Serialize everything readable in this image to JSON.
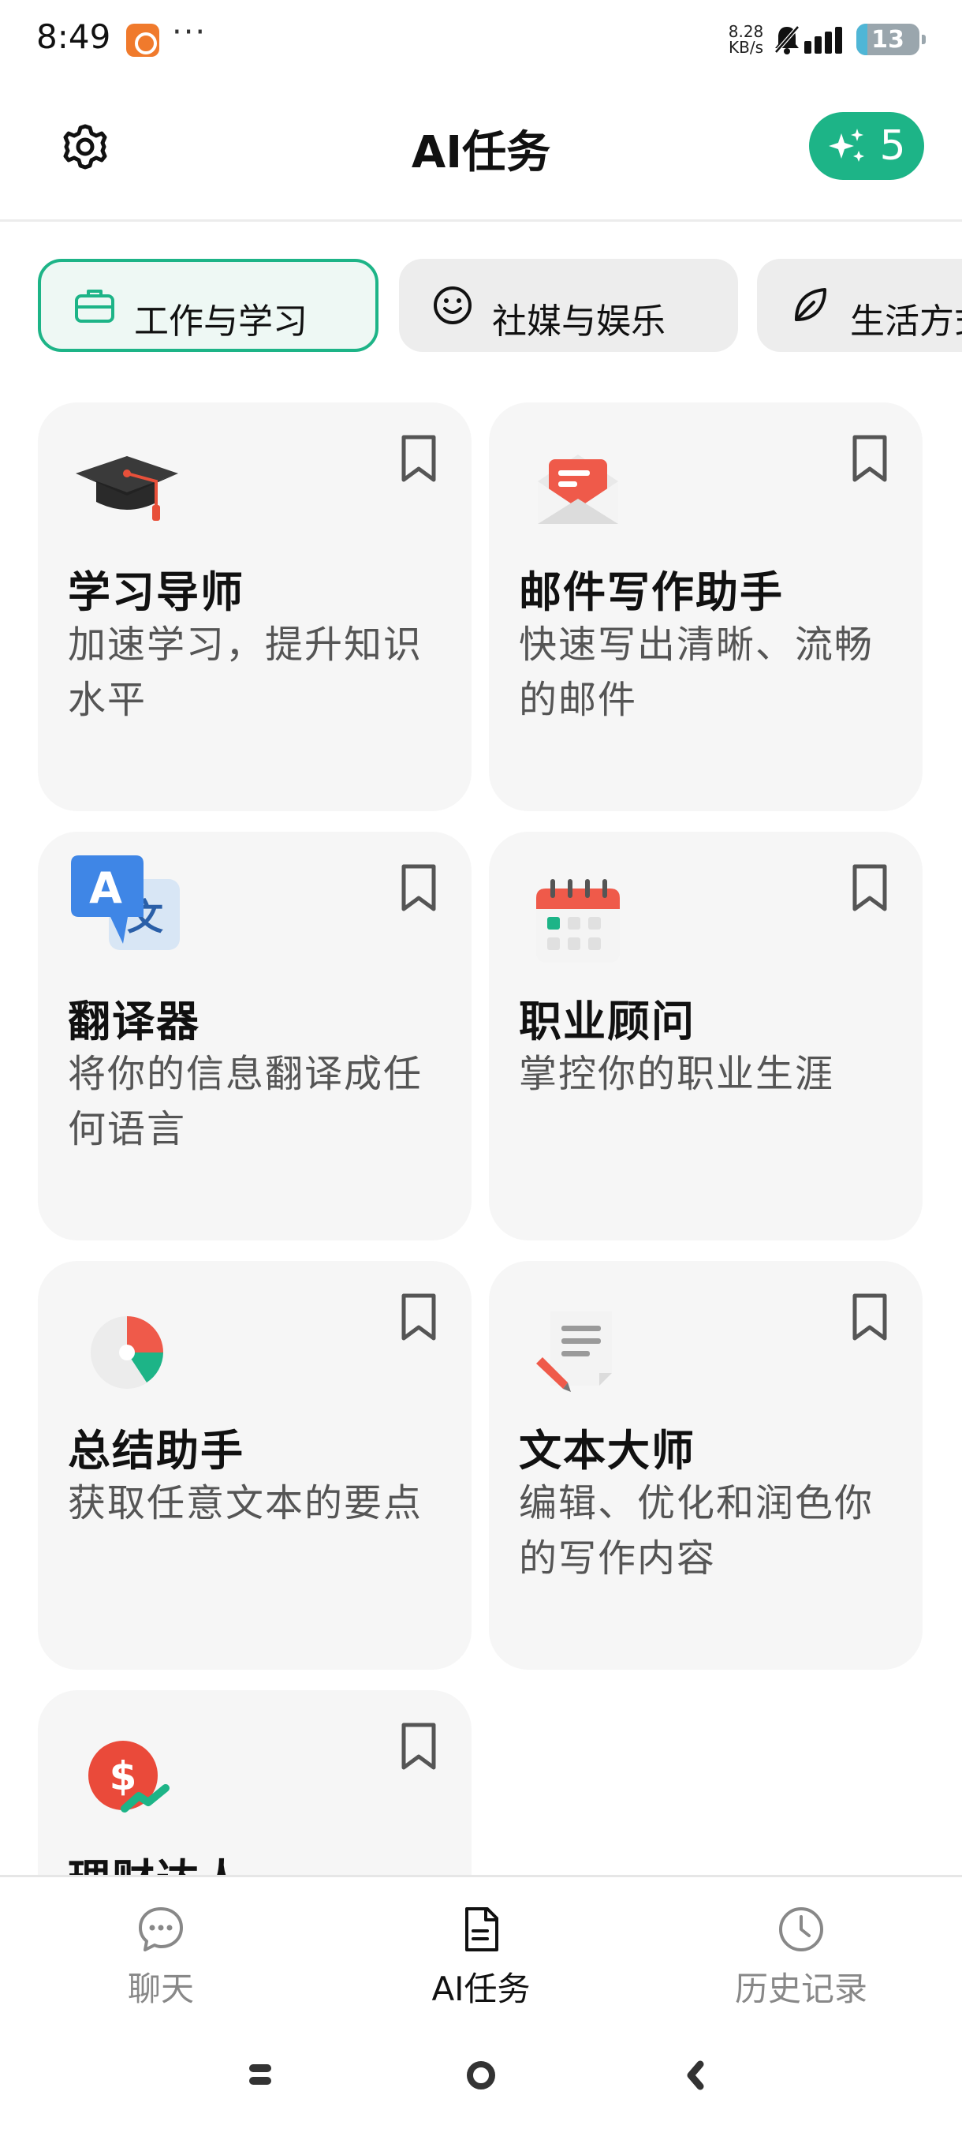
{
  "status_bar": {
    "time": "8:49",
    "more": "···",
    "speed_value": "8.28",
    "speed_unit": "KB/s",
    "battery": "13"
  },
  "header": {
    "title": "AI任务",
    "credits": "5"
  },
  "tabs": [
    {
      "label": "工作与学习",
      "icon": "briefcase-icon",
      "active": true
    },
    {
      "label": "社媒与娱乐",
      "icon": "smile-icon",
      "active": false
    },
    {
      "label": "生活方式",
      "icon": "leaf-icon",
      "active": false
    }
  ],
  "cards": [
    {
      "title": "学习导师",
      "desc": "加速学习，提升知识水平",
      "icon": "graduation-cap-icon"
    },
    {
      "title": "邮件写作助手",
      "desc": "快速写出清晰、流畅的邮件",
      "icon": "envelope-icon"
    },
    {
      "title": "翻译器",
      "desc": "将你的信息翻译成任何语言",
      "icon": "translate-icon"
    },
    {
      "title": "职业顾问",
      "desc": "掌控你的职业生涯",
      "icon": "calendar-icon"
    },
    {
      "title": "总结助手",
      "desc": "获取任意文本的要点",
      "icon": "pie-chart-icon"
    },
    {
      "title": "文本大师",
      "desc": "编辑、优化和润色你的写作内容",
      "icon": "document-pen-icon"
    },
    {
      "title": "理财达人",
      "desc": "",
      "icon": "dollar-coin-icon"
    }
  ],
  "bottom_nav": [
    {
      "label": "聊天",
      "icon": "chat-bubble-icon",
      "active": false
    },
    {
      "label": "AI任务",
      "icon": "document-icon",
      "active": true
    },
    {
      "label": "历史记录",
      "icon": "clock-icon",
      "active": false
    }
  ],
  "colors": {
    "accent": "#1db487",
    "card_bg": "#f6f6f6",
    "tab_bg": "#ededed"
  }
}
